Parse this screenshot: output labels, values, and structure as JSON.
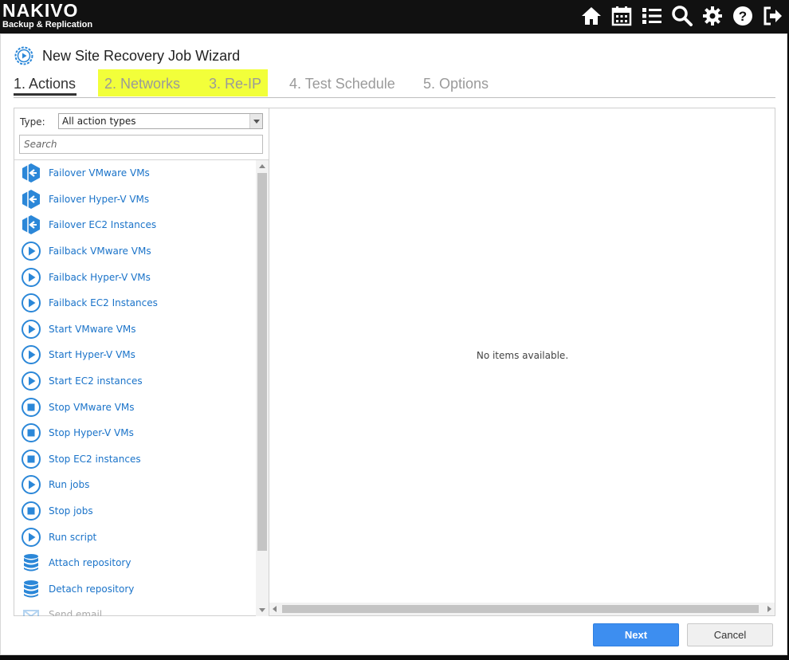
{
  "app": {
    "logo_main": "NAKIVO",
    "logo_sub": "Backup & Replication",
    "top_icons": [
      "home-icon",
      "calendar-icon",
      "list-icon",
      "search-icon",
      "gear-icon",
      "help-icon",
      "logout-icon"
    ]
  },
  "wizard": {
    "title": "New Site Recovery Job Wizard",
    "steps": [
      {
        "label": "1. Actions",
        "active": true
      },
      {
        "label": "2. Networks",
        "active": false
      },
      {
        "label": "3. Re-IP",
        "active": false
      },
      {
        "label": "4. Test Schedule",
        "active": false
      },
      {
        "label": "5. Options",
        "active": false
      }
    ],
    "highlight_color": "#f2ff3a"
  },
  "left_panel": {
    "type_label": "Type:",
    "type_value": "All action types",
    "search_placeholder": "Search",
    "items": [
      {
        "label": "Failover VMware VMs",
        "icon": "failover-icon"
      },
      {
        "label": "Failover Hyper-V VMs",
        "icon": "failover-icon"
      },
      {
        "label": "Failover EC2 Instances",
        "icon": "failover-icon"
      },
      {
        "label": "Failback VMware VMs",
        "icon": "play-icon"
      },
      {
        "label": "Failback Hyper-V VMs",
        "icon": "play-icon"
      },
      {
        "label": "Failback EC2 Instances",
        "icon": "play-icon"
      },
      {
        "label": "Start VMware VMs",
        "icon": "play-icon"
      },
      {
        "label": "Start Hyper-V VMs",
        "icon": "play-icon"
      },
      {
        "label": "Start EC2 instances",
        "icon": "play-icon"
      },
      {
        "label": "Stop VMware VMs",
        "icon": "stop-icon"
      },
      {
        "label": "Stop Hyper-V VMs",
        "icon": "stop-icon"
      },
      {
        "label": "Stop EC2 instances",
        "icon": "stop-icon"
      },
      {
        "label": "Run jobs",
        "icon": "play-icon"
      },
      {
        "label": "Stop jobs",
        "icon": "stop-icon"
      },
      {
        "label": "Run script",
        "icon": "play-icon"
      },
      {
        "label": "Attach repository",
        "icon": "database-icon"
      },
      {
        "label": "Detach repository",
        "icon": "database-icon"
      },
      {
        "label": "Send email",
        "icon": "email-icon"
      }
    ]
  },
  "right_panel": {
    "empty_text": "No items available."
  },
  "footer": {
    "next_label": "Next",
    "cancel_label": "Cancel"
  },
  "colors": {
    "accent": "#1a73c9",
    "primary_button": "#3d8ef0"
  }
}
